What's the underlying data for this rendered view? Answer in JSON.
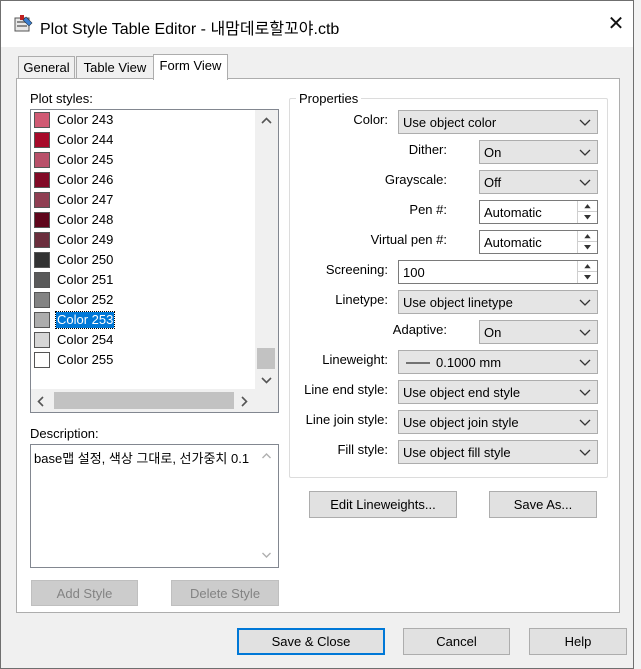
{
  "window": {
    "title": "Plot Style Table Editor - 내맘데로할꼬야.ctb",
    "close_glyph": "✕"
  },
  "tabs": [
    {
      "label": "General"
    },
    {
      "label": "Table View"
    },
    {
      "label": "Form View"
    }
  ],
  "plot_styles": {
    "label": "Plot styles:",
    "items": [
      {
        "label": "Color 243",
        "color": "#d05a73"
      },
      {
        "label": "Color 244",
        "color": "#a70a2a"
      },
      {
        "label": "Color 245",
        "color": "#b9506a"
      },
      {
        "label": "Color 246",
        "color": "#820a27"
      },
      {
        "label": "Color 247",
        "color": "#8f3e52"
      },
      {
        "label": "Color 248",
        "color": "#60061c"
      },
      {
        "label": "Color 249",
        "color": "#6b2e3d"
      },
      {
        "label": "Color 250",
        "color": "#333333"
      },
      {
        "label": "Color 251",
        "color": "#5a5a5a"
      },
      {
        "label": "Color 252",
        "color": "#838383"
      },
      {
        "label": "Color 253",
        "color": "#adadad"
      },
      {
        "label": "Color 254",
        "color": "#d6d6d6"
      },
      {
        "label": "Color 255",
        "color": "#ffffff"
      }
    ],
    "selected_index": 10
  },
  "description": {
    "label": "Description:",
    "text": "base맵 설정, 색상 그대로, 선가중치 0.1"
  },
  "buttons": {
    "add_style": "Add Style",
    "delete_style": "Delete Style",
    "edit_lineweights": "Edit Lineweights...",
    "save_as": "Save As...",
    "save_close": "Save & Close",
    "cancel": "Cancel",
    "help": "Help"
  },
  "properties": {
    "legend": "Properties",
    "color": {
      "label": "Color:",
      "value": "Use object color"
    },
    "dither": {
      "label": "Dither:",
      "value": "On"
    },
    "grayscale": {
      "label": "Grayscale:",
      "value": "Off"
    },
    "pen": {
      "label": "Pen #:",
      "value": "Automatic"
    },
    "virtual_pen": {
      "label": "Virtual pen #:",
      "value": "Automatic"
    },
    "screening": {
      "label": "Screening:",
      "value": "100"
    },
    "linetype": {
      "label": "Linetype:",
      "value": "Use object linetype"
    },
    "adaptive": {
      "label": "Adaptive:",
      "value": "On"
    },
    "lineweight": {
      "label": "Lineweight:",
      "value": "0.1000 mm"
    },
    "line_end_style": {
      "label": "Line end style:",
      "value": "Use object end style"
    },
    "line_join_style": {
      "label": "Line join style:",
      "value": "Use object join style"
    },
    "fill_style": {
      "label": "Fill style:",
      "value": "Use object fill style"
    }
  }
}
